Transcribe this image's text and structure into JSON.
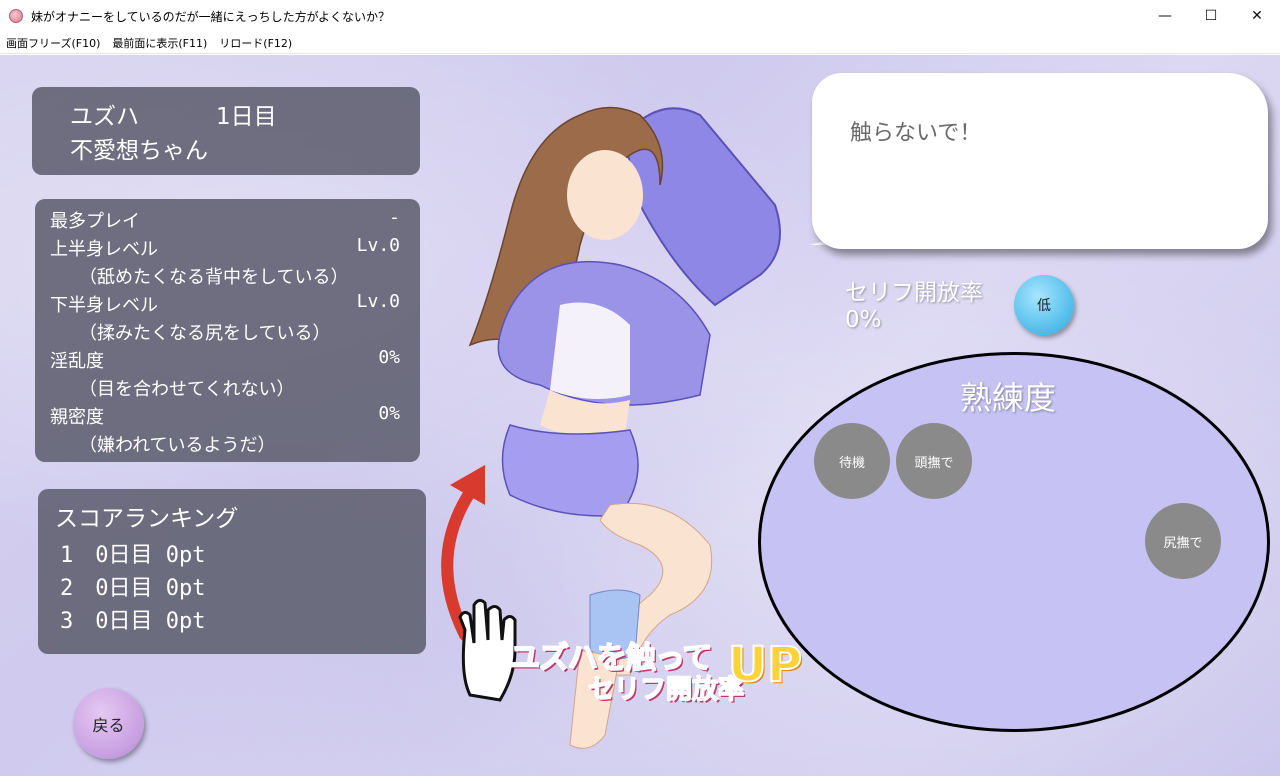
{
  "window": {
    "title": "妹がオナニーをしているのだが一緒にえっちした方がよくないか？",
    "controls": {
      "minimize": "—",
      "maximize": "☐",
      "close": "✕"
    }
  },
  "menu": {
    "items": [
      "画面フリーズ(F10)",
      "最前面に表示(F11)",
      "リロード(F12)"
    ]
  },
  "profile": {
    "name": "ユズハ",
    "day": "1日目",
    "trait": "不愛想ちゃん"
  },
  "stats": {
    "most_play_label": "最多プレイ",
    "most_play_value": "-",
    "upper_label": "上半身レベル",
    "upper_value": "Lv.0",
    "upper_desc": "（舐めたくなる背中をしている）",
    "lower_label": "下半身レベル",
    "lower_value": "Lv.0",
    "lower_desc": "（揉みたくなる尻をしている）",
    "lewd_label": "淫乱度",
    "lewd_value": "0%",
    "lewd_desc": "（目を合わせてくれない）",
    "intimacy_label": "親密度",
    "intimacy_value": "0%",
    "intimacy_desc": "（嫌われているようだ）"
  },
  "ranking": {
    "title": "スコアランキング",
    "rows": [
      "1　0日目 0pt",
      "2　0日目 0pt",
      "3　0日目 0pt"
    ]
  },
  "back_button": "戻る",
  "bubble": {
    "text": "触らないで！"
  },
  "serif": {
    "label": "セリフ開放率",
    "value": "0%",
    "level_button": "低"
  },
  "skills": {
    "title": "熟練度",
    "buttons": [
      "待機",
      "頭撫で",
      "尻撫で"
    ]
  },
  "promo": {
    "line1": "ユズハを触って",
    "line2": "セリフ開放率",
    "up": "UP"
  },
  "colors": {
    "panel": "#5f5f70",
    "background": "#d4d0f0",
    "oval": "#c6c2f3",
    "back_button": "#c69fe0",
    "low_button": "#4fbbe9",
    "skill_button": "#8a8a8a",
    "promo_pink": "#ff5d8b"
  }
}
